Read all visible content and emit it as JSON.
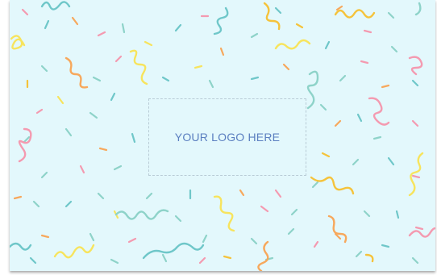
{
  "logo_placeholder": {
    "text": "YOUR LOGO HERE"
  },
  "colors": {
    "background": "#e3f8fc",
    "placeholder_text": "#5b7fc0",
    "placeholder_border": "#b9ccd6",
    "confetti": [
      "#f49ab0",
      "#f7e45d",
      "#6fc7c9",
      "#f7a85c",
      "#8ed3c9",
      "#f5c33b"
    ]
  }
}
